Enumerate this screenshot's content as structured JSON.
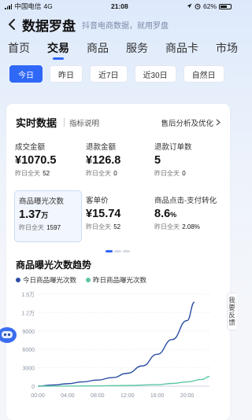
{
  "status": {
    "carrier": "中国电信",
    "network": "4G",
    "time": "21:08",
    "battery": "62%"
  },
  "header": {
    "title": "数据罗盘",
    "subtitle": "抖音电商数据，就用罗盘"
  },
  "nav_tabs": [
    {
      "label": "首页",
      "active": false
    },
    {
      "label": "交易",
      "active": true
    },
    {
      "label": "商品",
      "active": false
    },
    {
      "label": "服务",
      "active": false
    },
    {
      "label": "商品卡",
      "active": false
    },
    {
      "label": "市场",
      "active": false
    }
  ],
  "date_filters": [
    {
      "label": "今日",
      "active": true
    },
    {
      "label": "昨日",
      "active": false
    },
    {
      "label": "近7日",
      "active": false
    },
    {
      "label": "近30日",
      "active": false
    },
    {
      "label": "自然日",
      "active": false
    }
  ],
  "realtime": {
    "title": "实时数据",
    "desc": "指标说明",
    "link": "售后分析及优化",
    "metrics": [
      {
        "label": "成交金额",
        "value": "¥1070.5",
        "unit": "",
        "sub_label": "昨日全天",
        "sub_value": "52",
        "highlight": false
      },
      {
        "label": "退款金额",
        "value": "¥126.8",
        "unit": "",
        "sub_label": "昨日全天",
        "sub_value": "0",
        "highlight": false
      },
      {
        "label": "退款订单数",
        "value": "5",
        "unit": "",
        "sub_label": "昨日全天",
        "sub_value": "0",
        "highlight": false
      },
      {
        "label": "商品曝光次数",
        "value": "1.37",
        "unit": "万",
        "sub_label": "昨日全天",
        "sub_value": "1597",
        "highlight": true
      },
      {
        "label": "客单价",
        "value": "¥15.74",
        "unit": "",
        "sub_label": "昨日全天",
        "sub_value": "52",
        "highlight": false
      },
      {
        "label": "商品点击-支付转化",
        "value": "8.6",
        "unit": "%",
        "sub_label": "昨日全天",
        "sub_value": "2.08%",
        "highlight": false
      }
    ]
  },
  "trend": {
    "title": "商品曝光次数趋势",
    "legend": [
      {
        "name": "今日商品曝光次数",
        "color": "#2b4ea3"
      },
      {
        "name": "昨日商品曝光次数",
        "color": "#5cc7a4"
      }
    ]
  },
  "chart_data": {
    "type": "line",
    "y_ticks": [
      "0",
      "3000",
      "6000",
      "9000",
      "1.2万",
      "1.5万"
    ],
    "x_ticks": [
      "00:00",
      "04:00",
      "08:00",
      "12:00",
      "16:00",
      "20:00"
    ],
    "ylim": [
      0,
      15000
    ],
    "xlim": [
      0,
      23
    ],
    "series": [
      {
        "name": "今日商品曝光次数",
        "color": "#2b4ea3",
        "x": [
          0,
          2,
          4,
          6,
          8,
          10,
          12,
          14,
          16,
          18,
          20,
          21
        ],
        "values": [
          0,
          200,
          400,
          700,
          1000,
          1400,
          2100,
          3300,
          5200,
          7600,
          10700,
          13700
        ]
      },
      {
        "name": "昨日商品曝光次数",
        "color": "#5cc7a4",
        "x": [
          0,
          4,
          8,
          12,
          16,
          18,
          20,
          22,
          23
        ],
        "values": [
          0,
          20,
          60,
          120,
          250,
          450,
          700,
          1100,
          1597
        ]
      }
    ]
  },
  "floating": {
    "feedback": "我要反馈"
  }
}
